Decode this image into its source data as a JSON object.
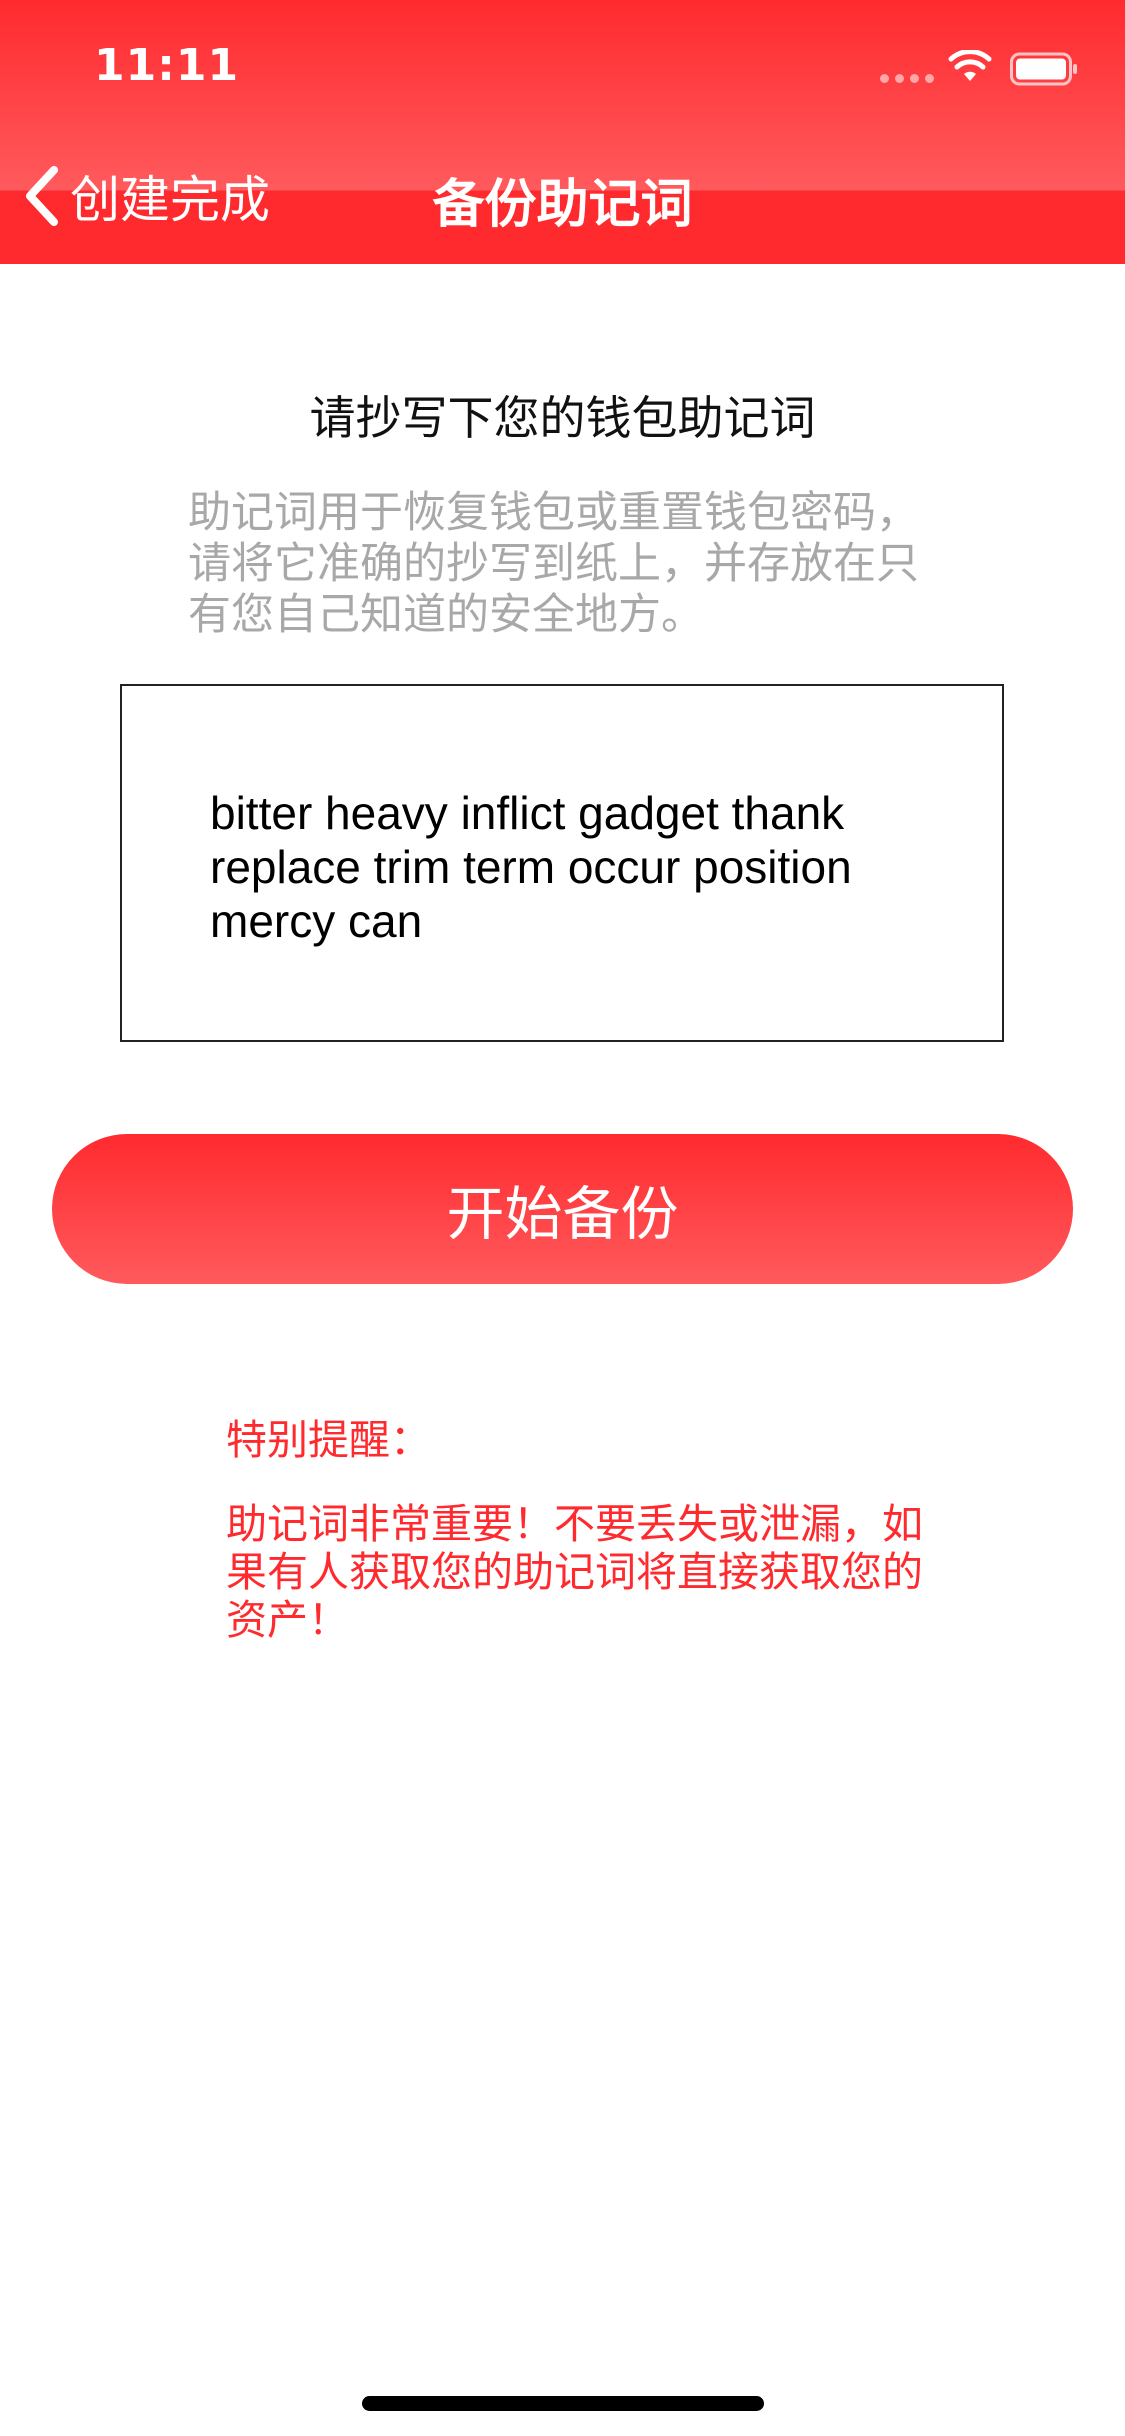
{
  "status_bar": {
    "time": "11:11"
  },
  "nav": {
    "back_label": "创建完成",
    "title": "备份助记词"
  },
  "main": {
    "heading": "请抄写下您的钱包助记词",
    "description": "助记词用于恢复钱包或重置钱包密码，请将它准确的抄写到纸上，并存放在只有您自己知道的安全地方。",
    "mnemonic": "bitter heavy inflict gadget thank replace trim term occur position mercy can",
    "start_button_label": "开始备份"
  },
  "notice": {
    "title": "特别提醒：",
    "body": "助记词非常重要！不要丢失或泄漏，如果有人获取您的助记词将直接获取您的资产！"
  },
  "colors": {
    "accent": "#ff2a2e",
    "description_text": "#a8a8a8"
  },
  "icons": [
    "back-chevron-icon",
    "wifi-icon",
    "battery-icon",
    "signal-icon"
  ]
}
